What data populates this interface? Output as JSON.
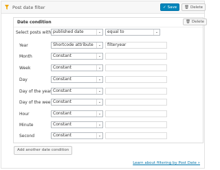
{
  "panel": {
    "title": "Post date filter",
    "save_label": "Save",
    "delete_label": "Delete"
  },
  "condition": {
    "title": "Date condition",
    "delete_label": "Delete",
    "select_label": "Select posts with",
    "field_value": "published date",
    "operator_value": "equal to",
    "rows": [
      {
        "label": "Year",
        "source": "Shortcode attribute",
        "value": "filteryear"
      },
      {
        "label": "Month",
        "source": "Constant",
        "value": ""
      },
      {
        "label": "Week",
        "source": "Constant",
        "value": ""
      },
      {
        "label": "Day",
        "source": "Constant",
        "value": ""
      },
      {
        "label": "Day of the year",
        "source": "Constant",
        "value": ""
      },
      {
        "label": "Day of the week",
        "source": "Constant",
        "value": ""
      },
      {
        "label": "Hour",
        "source": "Constant",
        "value": ""
      },
      {
        "label": "Minute",
        "source": "Constant",
        "value": ""
      },
      {
        "label": "Second",
        "source": "Constant",
        "value": ""
      }
    ]
  },
  "add_condition_label": "Add another date condition",
  "learn_link": "Learn about filtering by Post Date »"
}
